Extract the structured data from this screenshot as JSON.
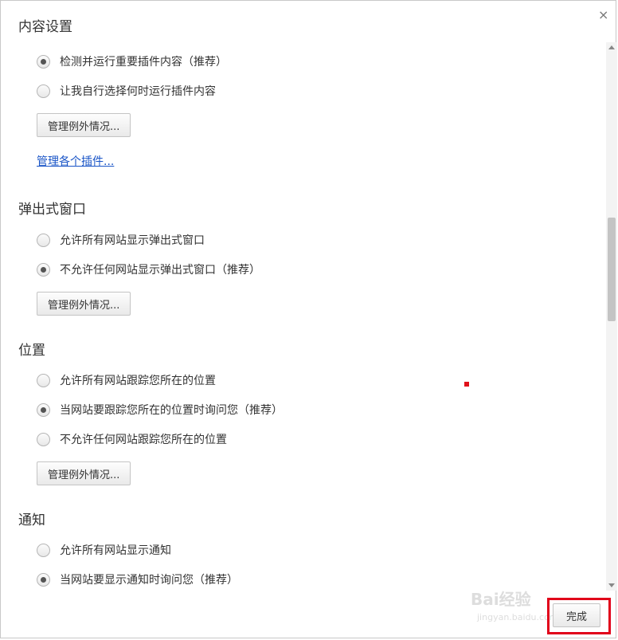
{
  "dialog": {
    "title": "内容设置",
    "close_glyph": "×",
    "done_label": "完成"
  },
  "plugins": {
    "options": [
      {
        "label": "检测并运行重要插件内容（推荐）",
        "checked": true
      },
      {
        "label": "让我自行选择何时运行插件内容",
        "checked": false
      }
    ],
    "exceptions_button": "管理例外情况...",
    "manage_link": "管理各个插件..."
  },
  "popups": {
    "title": "弹出式窗口",
    "options": [
      {
        "label": "允许所有网站显示弹出式窗口",
        "checked": false
      },
      {
        "label": "不允许任何网站显示弹出式窗口（推荐）",
        "checked": true
      }
    ],
    "exceptions_button": "管理例外情况..."
  },
  "location": {
    "title": "位置",
    "options": [
      {
        "label": "允许所有网站跟踪您所在的位置",
        "checked": false
      },
      {
        "label": "当网站要跟踪您所在的位置时询问您（推荐）",
        "checked": true
      },
      {
        "label": "不允许任何网站跟踪您所在的位置",
        "checked": false
      }
    ],
    "exceptions_button": "管理例外情况..."
  },
  "notifications": {
    "title": "通知",
    "options": [
      {
        "label": "允许所有网站显示通知",
        "checked": false
      },
      {
        "label": "当网站要显示通知时询问您（推荐）",
        "checked": true
      }
    ]
  },
  "watermark": {
    "logo": "Bai经验",
    "sub": "jingyan.baidu.com"
  },
  "colors": {
    "link": "#1a55c7",
    "highlight": "#e1001a"
  }
}
